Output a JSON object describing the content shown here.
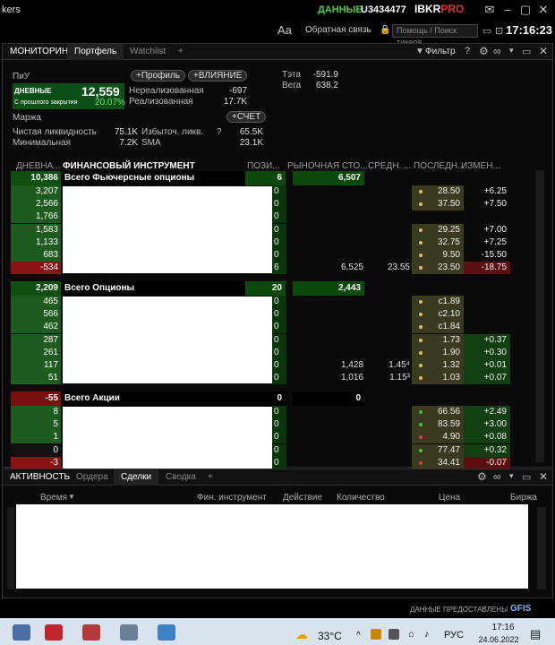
{
  "titlebar": {
    "title_fragment": "kers",
    "data_label": "ДАННЫЕ",
    "account": "U3434477",
    "logo_main": "IBKR",
    "logo_pro": "PRO"
  },
  "toolbar": {
    "font_size_label": "Aa",
    "feedback_label": "Обратная связь",
    "search_placeholder": "Помощь / Поиск тикера",
    "time": "17:16:23"
  },
  "top_tabs": [
    "МОНИТОРИНГ",
    "Портфель",
    "Watchlist",
    "+"
  ],
  "top_icons": {
    "filter_label": "Фильтр",
    "help": "?"
  },
  "summary": {
    "pnl_label": "ПиУ",
    "daily_label": "ДНЕВНЫЕ",
    "daily_value": "12,559",
    "since_close_label": "С прошлого закрытия",
    "since_close_pct": "20.07%",
    "profile_btn": "Профиль",
    "influence_btn": "ВЛИЯНИЕ",
    "unrealized_label": "Нереализованная",
    "unrealized_value": "-697",
    "realized_label": "Реализованная",
    "realized_value": "17.7K",
    "theta_label": "Тэта",
    "theta_value": "-591.9",
    "vega_label": "Вега",
    "vega_value": "638.2",
    "margin_label": "Маржа",
    "account_btn": "СЧЕТ",
    "net_liq_label": "Чистая ликвидность",
    "net_liq_value": "75.1K",
    "excess_liq_label": "Избыточ. ликв.",
    "excess_liq_q": "?",
    "excess_liq_value": "65.5K",
    "min_label": "Минимальная",
    "min_value": "7.2K",
    "sma_label": "SMA",
    "sma_value": "23.1K"
  },
  "grid": {
    "headers": {
      "daily": "ДНЕВНА...",
      "instrument": "ФИНАНСОВЫЙ ИНСТРУМЕНТ",
      "position": "ПОЗИ...",
      "market_value": "РЫНОЧНАЯ СТО...",
      "avg": "СРЕДН. ...",
      "last": "ПОСЛЕДН...",
      "change": "ИЗМЕН..."
    },
    "groups": [
      {
        "pnl": "10,386",
        "pnl_neg": false,
        "name": "Всего Фьючерсные опционы",
        "position": "6",
        "market_value": "6,507",
        "rows": [
          {
            "pnl": "3,207",
            "pnl_class": "",
            "pos": "0",
            "mv": "",
            "avg": "",
            "last": "28.50",
            "chg": "+6.25",
            "chg_class": "",
            "dot": "#d9c35a"
          },
          {
            "pnl": "2,566",
            "pnl_class": "",
            "pos": "0",
            "mv": "",
            "avg": "",
            "last": "37.50",
            "chg": "+7.50",
            "chg_class": "",
            "dot": "#d9c35a"
          },
          {
            "pnl": "1,766",
            "pnl_class": "",
            "pos": "0",
            "mv": "",
            "avg": "",
            "last": "",
            "chg": "",
            "chg_class": "",
            "dot": ""
          },
          {
            "pnl": "1,583",
            "pnl_class": "",
            "pos": "0",
            "mv": "",
            "avg": "",
            "last": "29.25",
            "chg": "+7.00",
            "chg_class": "",
            "dot": "#d9c35a"
          },
          {
            "pnl": "1,133",
            "pnl_class": "",
            "pos": "0",
            "mv": "",
            "avg": "",
            "last": "32.75",
            "chg": "+7.25",
            "chg_class": "",
            "dot": "#d9c35a"
          },
          {
            "pnl": "683",
            "pnl_class": "",
            "pos": "0",
            "mv": "",
            "avg": "",
            "last": "9.50",
            "chg": "-15.50",
            "chg_class": "",
            "dot": "#d9c35a"
          },
          {
            "pnl": "-534",
            "pnl_class": "neg",
            "pos": "6",
            "mv": "6,525",
            "avg": "23.55",
            "last": "23.50",
            "chg": "-18.75",
            "chg_class": "neg",
            "dot": "#d9c35a"
          }
        ]
      },
      {
        "pnl": "2,209",
        "pnl_neg": false,
        "name": "Всего Опционы",
        "position": "20",
        "market_value": "2,443",
        "rows": [
          {
            "pnl": "465",
            "pnl_class": "",
            "pos": "0",
            "mv": "",
            "avg": "",
            "last": "c1.89",
            "chg": "",
            "chg_class": "",
            "dot": "#d9c35a"
          },
          {
            "pnl": "566",
            "pnl_class": "",
            "pos": "0",
            "mv": "",
            "avg": "",
            "last": "c2.10",
            "chg": "",
            "chg_class": "",
            "dot": "#d9c35a"
          },
          {
            "pnl": "462",
            "pnl_class": "",
            "pos": "0",
            "mv": "",
            "avg": "",
            "last": "c1.84",
            "chg": "",
            "chg_class": "",
            "dot": "#d9c35a"
          },
          {
            "pnl": "287",
            "pnl_class": "",
            "pos": "0",
            "mv": "",
            "avg": "",
            "last": "1.73",
            "chg": "+0.37",
            "chg_class": "pos",
            "dot": "#d9c35a"
          },
          {
            "pnl": "261",
            "pnl_class": "",
            "pos": "0",
            "mv": "",
            "avg": "",
            "last": "1.90",
            "chg": "+0.30",
            "chg_class": "pos",
            "dot": "#d9c35a"
          },
          {
            "pnl": "117",
            "pnl_class": "",
            "pos": "0",
            "mv": "1,428",
            "avg": "1.45⁴",
            "last": "1.32",
            "chg": "+0.01",
            "chg_class": "pos",
            "dot": "#d9c35a"
          },
          {
            "pnl": "51",
            "pnl_class": "",
            "pos": "0",
            "mv": "1,016",
            "avg": "1.15³",
            "last": "1.03",
            "chg": "+0.07",
            "chg_class": "pos",
            "dot": "#d9c35a"
          }
        ]
      },
      {
        "pnl": "-55",
        "pnl_neg": true,
        "name": "Всего Акции",
        "position": "0",
        "market_value": "0",
        "rows": [
          {
            "pnl": "8",
            "pnl_class": "",
            "pos": "0",
            "mv": "",
            "avg": "",
            "last": "66.56",
            "chg": "+2.49",
            "chg_class": "pos",
            "dot": "#3fbf3f"
          },
          {
            "pnl": "5",
            "pnl_class": "",
            "pos": "0",
            "mv": "",
            "avg": "",
            "last": "83.59",
            "chg": "+3.00",
            "chg_class": "pos",
            "dot": "#3fbf3f"
          },
          {
            "pnl": "1",
            "pnl_class": "",
            "pos": "0",
            "mv": "",
            "avg": "",
            "last": "4.90",
            "chg": "+0.08",
            "chg_class": "pos",
            "dot": "#d04040"
          },
          {
            "pnl": "0",
            "pnl_class": "zero",
            "pos": "0",
            "mv": "",
            "avg": "",
            "last": "77.47",
            "chg": "+0.32",
            "chg_class": "pos",
            "dot": "#3fbf3f"
          },
          {
            "pnl": "-3",
            "pnl_class": "neg",
            "pos": "0",
            "mv": "",
            "avg": "",
            "last": "34.41",
            "chg": "-0.07",
            "chg_class": "neg",
            "dot": "#d04040"
          }
        ]
      }
    ]
  },
  "bottom_tabs": [
    "АКТИВНОСТЬ",
    "Ордера",
    "Сделки",
    "Сводка",
    "+"
  ],
  "bottom_headers": {
    "time": "Время",
    "instrument": "Фин. инструмент",
    "action": "Действие",
    "quantity": "Количество",
    "price": "Цена",
    "exchange": "Биржа"
  },
  "data_provider": "ДАННЫЕ ПРЕДОСТАВЛЕНЫ",
  "data_provider_logo": "GFIS",
  "taskbar": {
    "temperature": "33°C",
    "language": "РУС",
    "time": "17:16",
    "date": "24.06.2022"
  },
  "colors": {
    "green_cell": "#1e5b1e",
    "red_cell": "#8a1414",
    "data_green": "#3fcf3f",
    "brand_red": "#e0322f"
  }
}
